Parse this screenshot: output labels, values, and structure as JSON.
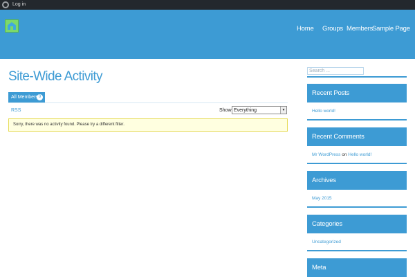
{
  "adminbar": {
    "login": "Log in"
  },
  "header": {
    "nav": [
      "Home",
      "Groups",
      "Members",
      "Sample Page"
    ]
  },
  "main": {
    "title": "Site-Wide Activity",
    "tab": {
      "label": "All Members",
      "count": "0"
    },
    "rss": "RSS",
    "show_label": "Show:",
    "show_value": "Everything",
    "notice": "Sorry, there was no activity found. Please try a different filter."
  },
  "sidebar": {
    "search_placeholder": "Search ...",
    "recent_posts": {
      "title": "Recent Posts",
      "items": [
        "Hello world!"
      ]
    },
    "recent_comments": {
      "title": "Recent Comments",
      "author": "Mr WordPress",
      "on": "on",
      "post": "Hello world!"
    },
    "archives": {
      "title": "Archives",
      "items": [
        "May 2015"
      ]
    },
    "categories": {
      "title": "Categories",
      "items": [
        "Uncategorized"
      ]
    },
    "meta": {
      "title": "Meta"
    }
  },
  "colors": {
    "accent": "#3d9bd4",
    "adminbar": "#23282d",
    "notice_bg": "#ffffe0",
    "notice_border": "#e6db55"
  }
}
